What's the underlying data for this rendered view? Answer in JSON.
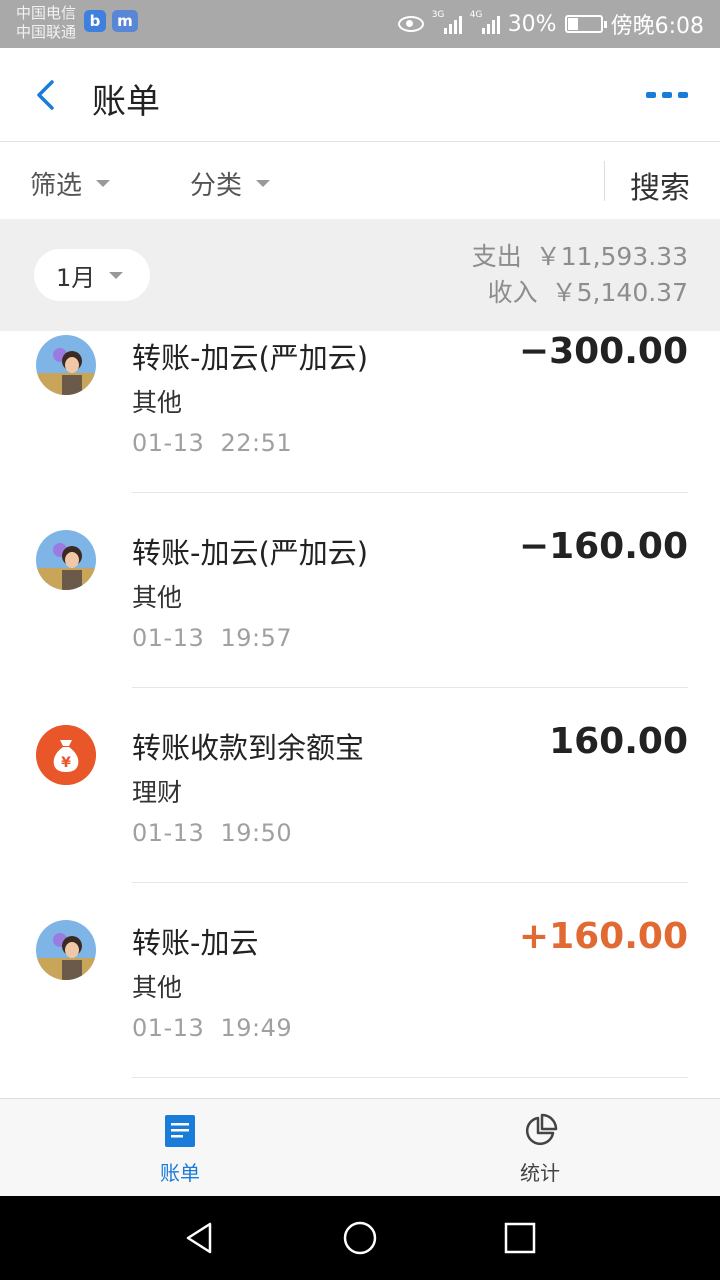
{
  "status_bar": {
    "carrier_1": "中国电信",
    "carrier_2": "中国联通",
    "app_icon_1": "b",
    "app_icon_2": "m",
    "network_1": "3G",
    "network_2": "4G",
    "battery": "30%",
    "time": "傍晚6:08"
  },
  "header": {
    "title": "账单"
  },
  "filters": {
    "filter_label": "筛选",
    "category_label": "分类",
    "search_label": "搜索"
  },
  "month": {
    "selected": "1月",
    "expense_label": "支出",
    "expense_value": "￥11,593.33",
    "income_label": "收入",
    "income_value": "￥5,140.37"
  },
  "transactions": [
    {
      "title": "转账-加云(严加云)",
      "category": "其他",
      "date": "01-13",
      "time": "22:51",
      "amount": "−300.00",
      "type": "expense",
      "icon": "avatar"
    },
    {
      "title": "转账-加云(严加云)",
      "category": "其他",
      "date": "01-13",
      "time": "19:57",
      "amount": "−160.00",
      "type": "expense",
      "icon": "avatar"
    },
    {
      "title": "转账收款到余额宝",
      "category": "理财",
      "date": "01-13",
      "time": "19:50",
      "amount": "160.00",
      "type": "neutral",
      "icon": "money-bag-icon"
    },
    {
      "title": "转账-加云",
      "category": "其他",
      "date": "01-13",
      "time": "19:49",
      "amount": "+160.00",
      "type": "income",
      "icon": "avatar"
    }
  ],
  "tabs": [
    {
      "label": "账单",
      "icon": "bill-list-icon",
      "active": true
    },
    {
      "label": "统计",
      "icon": "pie-chart-icon",
      "active": false
    }
  ],
  "colors": {
    "accent": "#1a7cd9",
    "income": "#e06a32",
    "coin": "#e8562a"
  }
}
